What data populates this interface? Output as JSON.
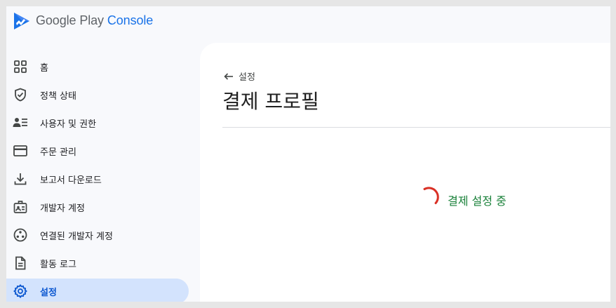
{
  "app": {
    "brand_name": "Google Play",
    "brand_product": "Console",
    "logo_icon": "play-console-logo-icon"
  },
  "sidebar": {
    "items": [
      {
        "label": "홈",
        "icon": "dashboard-grid-icon"
      },
      {
        "label": "정책 상태",
        "icon": "shield-check-icon"
      },
      {
        "label": "사용자 및 권한",
        "icon": "people-list-icon"
      },
      {
        "label": "주문 관리",
        "icon": "credit-card-icon"
      },
      {
        "label": "보고서 다운로드",
        "icon": "download-icon"
      },
      {
        "label": "개발자 계정",
        "icon": "id-badge-icon"
      },
      {
        "label": "연결된 개발자 계정",
        "icon": "linked-accounts-icon"
      },
      {
        "label": "활동 로그",
        "icon": "document-log-icon"
      },
      {
        "label": "설정",
        "icon": "gear-icon",
        "active": true
      }
    ]
  },
  "main": {
    "back_label": "설정",
    "title": "결제 프로필",
    "loading_text": "결제 설정 중"
  },
  "colors": {
    "accent": "#1a73e8",
    "active_bg": "#d3e3fd",
    "active_text": "#0b57d0",
    "spinner": "#d93025",
    "loading_text": "#188038"
  }
}
